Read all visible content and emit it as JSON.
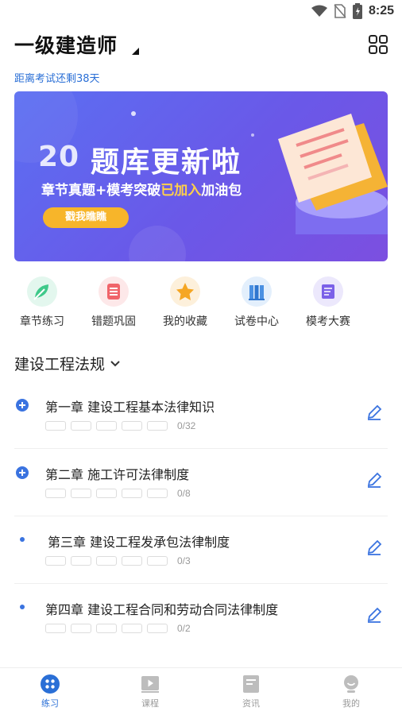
{
  "status_bar": {
    "time": "8:25"
  },
  "header": {
    "title": "一级建造师",
    "countdown": "距离考试还剩38天"
  },
  "banner": {
    "year": "20",
    "headline": "题库更新啦",
    "sub_part1": "章节真题+模考突破",
    "sub_highlight": "已加入",
    "sub_part2": "加油包",
    "button": "戳我瞧瞧"
  },
  "quick_menu": [
    {
      "label": "章节练习",
      "icon": "leaf-pen-icon",
      "color": "#3fc98a",
      "bg": "#e3f7ee"
    },
    {
      "label": "错题巩固",
      "icon": "list-stack-icon",
      "color": "#f0646a",
      "bg": "#fde8e9"
    },
    {
      "label": "我的收藏",
      "icon": "star-icon",
      "color": "#f5a623",
      "bg": "#fdf0db"
    },
    {
      "label": "试卷中心",
      "icon": "books-icon",
      "color": "#4a90e2",
      "bg": "#e3effc"
    },
    {
      "label": "模考大赛",
      "icon": "exam-icon",
      "color": "#7b61e8",
      "bg": "#ece8fc"
    }
  ],
  "subject": {
    "label": "建设工程法规"
  },
  "chapters": [
    {
      "title": "第一章 建设工程基本法律知识",
      "count": "0/32",
      "marker": "plus"
    },
    {
      "title": "第二章 施工许可法律制度",
      "count": "0/8",
      "marker": "plus"
    },
    {
      "title": "第三章 建设工程发承包法律制度",
      "count": "0/3",
      "marker": "dot"
    },
    {
      "title": "第四章 建设工程合同和劳动合同法律制度",
      "count": "0/2",
      "marker": "dot"
    }
  ],
  "bottom_nav": [
    {
      "label": "练习",
      "icon": "practice-icon",
      "active": true
    },
    {
      "label": "课程",
      "icon": "play-icon",
      "active": false
    },
    {
      "label": "资讯",
      "icon": "news-icon",
      "active": false
    },
    {
      "label": "我的",
      "icon": "profile-icon",
      "active": false
    }
  ],
  "colors": {
    "accent": "#2a6fd6",
    "banner_start": "#5b6ff2",
    "banner_end": "#7c4fe0",
    "button": "#f7b52a"
  }
}
